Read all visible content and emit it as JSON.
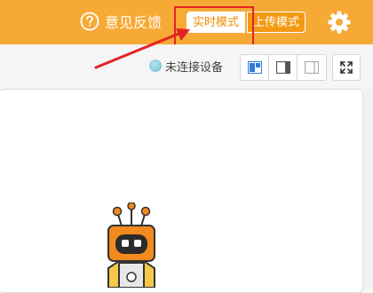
{
  "header": {
    "feedback_label": "意见反馈",
    "modes": [
      {
        "label": "实时模式",
        "active": true
      },
      {
        "label": "上传模式",
        "active": false
      }
    ]
  },
  "toolbar": {
    "device_status": "未连接设备",
    "layout_icons": [
      "layout-split-left-icon",
      "layout-panel-right-icon",
      "layout-panel-right-light-icon"
    ],
    "fullscreen_icon": "expand-icon"
  },
  "colors": {
    "header_bg": "#f7a936",
    "accent_orange": "#f08c00",
    "annotation_red": "#e32222"
  }
}
